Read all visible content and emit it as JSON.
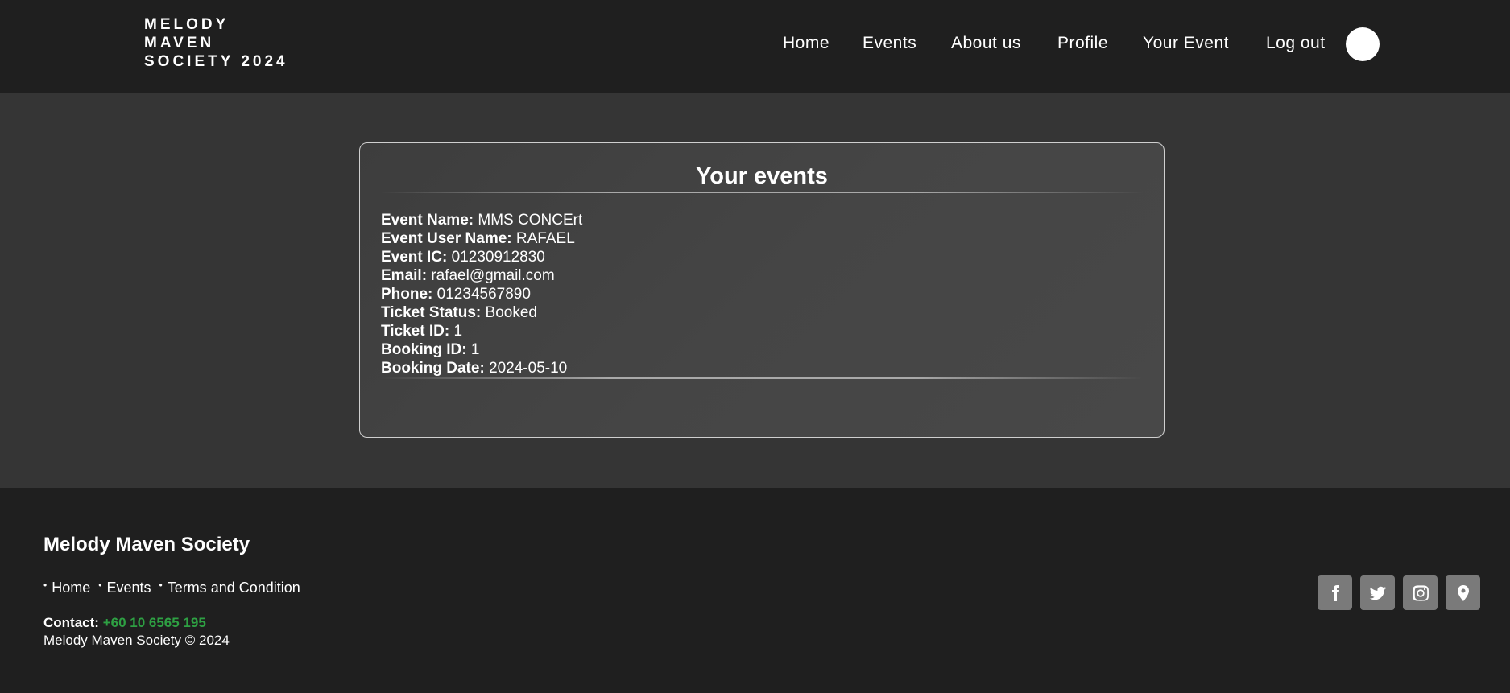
{
  "header": {
    "logo_lines": [
      "MELODY",
      "MAVEN",
      "SOCIETY 2024"
    ],
    "nav": [
      "Home",
      "Events",
      "About us",
      "Profile",
      "Your Event",
      "Log out"
    ]
  },
  "card": {
    "title": "Your events",
    "fields": [
      {
        "label": "Event Name:",
        "value": "MMS CONCErt"
      },
      {
        "label": "Event User Name:",
        "value": "RAFAEL"
      },
      {
        "label": "Event IC:",
        "value": "01230912830"
      },
      {
        "label": "Email:",
        "value": "rafael@gmail.com"
      },
      {
        "label": "Phone:",
        "value": "01234567890"
      },
      {
        "label": "Ticket Status:",
        "value": "Booked"
      },
      {
        "label": "Ticket ID:",
        "value": "1"
      },
      {
        "label": "Booking ID:",
        "value": "1"
      },
      {
        "label": "Booking Date:",
        "value": "2024-05-10"
      }
    ]
  },
  "footer": {
    "title": "Melody Maven Society",
    "links": [
      "Home",
      "Events",
      "Terms and Condition"
    ],
    "contact_label": "Contact:",
    "contact_phone": "+60 10 6565 195",
    "copyright": "Melody Maven Society © 2024",
    "social_icons": [
      "facebook-icon",
      "twitter-icon",
      "instagram-icon",
      "location-pin-icon"
    ]
  },
  "colors": {
    "header_bg": "#1f1f1f",
    "page_bg": "#353535",
    "accent_phone": "#2ea043",
    "social_bg": "#7a7a7a"
  }
}
